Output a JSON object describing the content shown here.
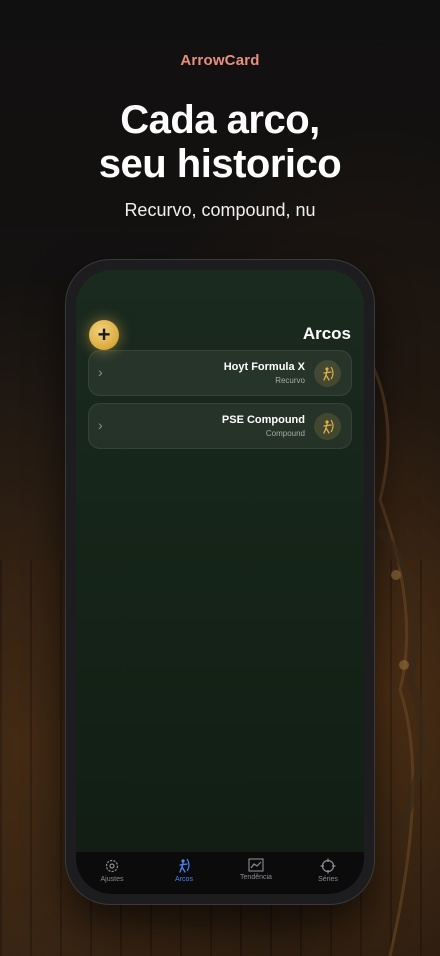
{
  "header": {
    "brand": "ArrowCard",
    "headline_line1": "Cada arco,",
    "headline_line2": "seu historico",
    "subhead": "Recurvo, compound, nu"
  },
  "screen": {
    "title": "Arcos",
    "add_label": "+",
    "bows": [
      {
        "name": "Hoyt Formula X",
        "type": "Recurvo"
      },
      {
        "name": "PSE Compound",
        "type": "Compound"
      }
    ]
  },
  "tabs": [
    {
      "label": "Ajustes",
      "icon": "gear-icon"
    },
    {
      "label": "Arcos",
      "icon": "archer-icon",
      "active": true
    },
    {
      "label": "Tendência",
      "icon": "trend-chart-icon"
    },
    {
      "label": "Séries",
      "icon": "crosshair-icon"
    }
  ],
  "colors": {
    "brand": "#e8907e",
    "accent_gold": "#e0b04a",
    "tab_active": "#4f86f7"
  }
}
